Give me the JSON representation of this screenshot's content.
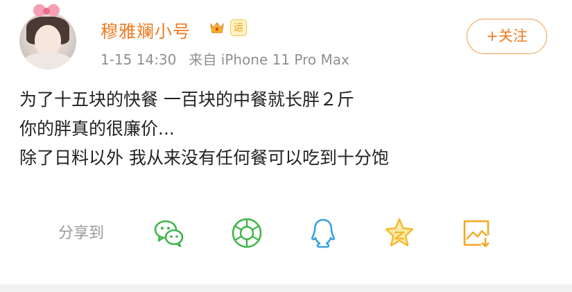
{
  "user": {
    "name": "穆雅斓小号",
    "badge_tag": "运",
    "time": "1-15 14:30",
    "source": "来自 iPhone 11 Pro Max"
  },
  "follow_button": {
    "label": "+关注"
  },
  "post": {
    "lines": [
      "为了十五块的快餐 一百块的中餐就长胖２斤",
      "你的胖真的很廉价...",
      "除了日料以外 我从来没有任何餐可以吃到十分饱"
    ]
  },
  "share": {
    "label": "分享到",
    "targets": [
      "wechat-icon",
      "moments-icon",
      "qq-icon",
      "qzone-icon",
      "save-image-icon"
    ]
  },
  "colors": {
    "accent": "#f07a22",
    "wechat": "#3fb549",
    "qq": "#3aa0e4",
    "qzone": "#f5b82e"
  }
}
